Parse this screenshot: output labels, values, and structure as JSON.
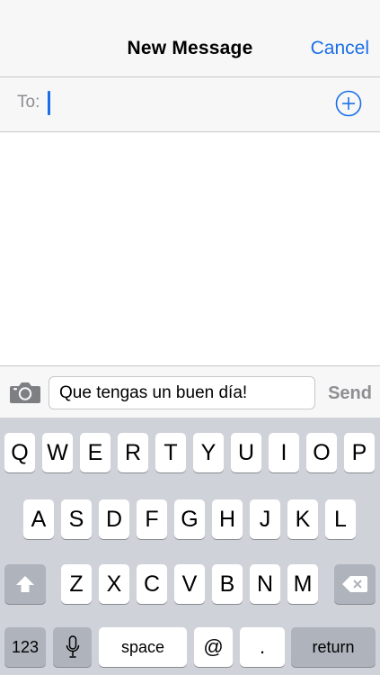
{
  "header": {
    "title": "New Message",
    "cancel_label": "Cancel"
  },
  "recipients": {
    "to_label": "To:",
    "value": ""
  },
  "icons": {
    "add_contact": "plus-circle-icon",
    "camera": "camera-icon",
    "shift": "shift-icon",
    "delete": "backspace-icon",
    "microphone": "microphone-icon"
  },
  "compose": {
    "message_text": "Que tengas un buen día!",
    "send_label": "Send"
  },
  "keyboard": {
    "row1": [
      "Q",
      "W",
      "E",
      "R",
      "T",
      "Y",
      "U",
      "I",
      "O",
      "P"
    ],
    "row2": [
      "A",
      "S",
      "D",
      "F",
      "G",
      "H",
      "J",
      "K",
      "L"
    ],
    "row3": [
      "Z",
      "X",
      "C",
      "V",
      "B",
      "N",
      "M"
    ],
    "numbers_label": "123",
    "space_label": "space",
    "at_label": "@",
    "period_label": ".",
    "return_label": "return"
  },
  "colors": {
    "accent": "#1a6ee8",
    "disabled": "#8e8e93",
    "keyboard_bg": "#cfd3d9",
    "function_key": "#aeb3bc"
  }
}
